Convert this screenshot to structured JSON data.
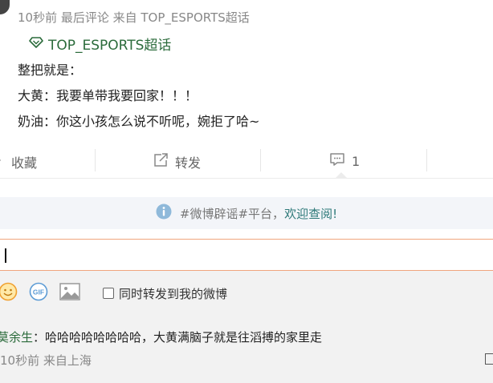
{
  "post": {
    "meta": "10秒前 最后评论 来自 TOP_ESPORTS超话",
    "topic_link": "TOP_ESPORTS超话",
    "lines": [
      "整把就是：",
      "大黄：我要单带我要回家！！！",
      "奶油：你这小孩怎么说不听呢，婉拒了哈~"
    ]
  },
  "actions": {
    "favorite": "收藏",
    "repost": "转发",
    "comment_count": "1"
  },
  "notice": {
    "text": "#微博辟谣#平台，",
    "link": "欢迎查阅!"
  },
  "composer": {
    "repost_checkbox_label": "同时转发到我的微博",
    "gif_label": "GIF",
    "input_value": ""
  },
  "comments": [
    {
      "user": "莫余生",
      "text": "：哈哈哈哈哈哈哈哈，大黄满脑子就是往滔搏的家里走",
      "meta": "10秒前 来自上海"
    }
  ],
  "colors": {
    "accent_green": "#2b6b3b",
    "input_border": "#f0a57e",
    "notice_bg": "#f3f5f9"
  }
}
